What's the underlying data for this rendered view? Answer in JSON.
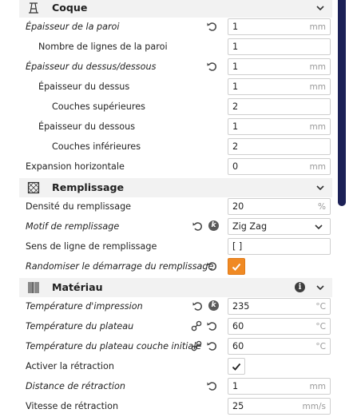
{
  "sections": {
    "shell": {
      "title": "Coque",
      "icon": "shell-icon"
    },
    "infill": {
      "title": "Remplissage",
      "icon": "infill-icon"
    },
    "material": {
      "title": "Matériau",
      "icon": "material-icon"
    }
  },
  "rows": {
    "wall_thickness": {
      "label": "Épaisseur de la paroi",
      "value": "1",
      "unit": "mm"
    },
    "wall_line_count": {
      "label": "Nombre de lignes de la paroi",
      "value": "1"
    },
    "top_bottom_thickness": {
      "label": "Épaisseur du dessus/dessous",
      "value": "1",
      "unit": "mm"
    },
    "top_thickness": {
      "label": "Épaisseur du dessus",
      "value": "1",
      "unit": "mm"
    },
    "top_layers": {
      "label": "Couches supérieures",
      "value": "2"
    },
    "bottom_thickness": {
      "label": "Épaisseur du dessous",
      "value": "1",
      "unit": "mm"
    },
    "bottom_layers": {
      "label": "Couches inférieures",
      "value": "2"
    },
    "horizontal_expansion": {
      "label": "Expansion horizontale",
      "value": "0",
      "unit": "mm"
    },
    "infill_density": {
      "label": "Densité du remplissage",
      "value": "20",
      "unit": "%"
    },
    "infill_pattern": {
      "label": "Motif de remplissage",
      "value": "Zig Zag"
    },
    "infill_line_directions": {
      "label": "Sens de ligne de remplissage",
      "value": "[ ]"
    },
    "randomize_infill_start": {
      "label": "Randomiser le démarrage du remplissage",
      "checked": true
    },
    "print_temperature": {
      "label": "Température d'impression",
      "value": "235",
      "unit": "°C"
    },
    "bed_temperature": {
      "label": "Température du plateau",
      "value": "60",
      "unit": "°C"
    },
    "bed_temperature_initial": {
      "label": "Température du plateau couche initiale",
      "value": "60",
      "unit": "°C"
    },
    "enable_retraction": {
      "label": "Activer la rétraction",
      "checked": true
    },
    "retraction_distance": {
      "label": "Distance de rétraction",
      "value": "1",
      "unit": "mm"
    },
    "retraction_speed": {
      "label": "Vitesse de rétraction",
      "value": "25",
      "unit": "mm/s"
    }
  },
  "colors": {
    "accent": "#f08a24",
    "scrollbar": "#1c2157",
    "header_bg": "#f2f2f2"
  },
  "icons": {
    "info": "i",
    "locked_profile": "k"
  }
}
